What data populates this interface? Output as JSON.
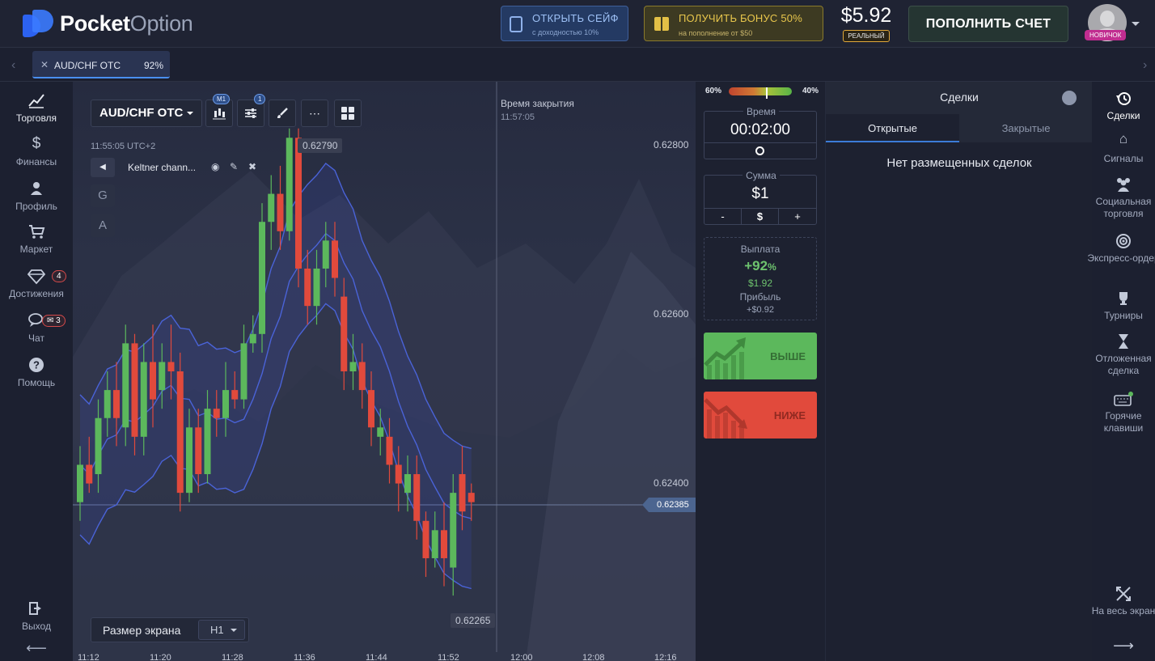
{
  "header": {
    "brand_bold": "Pocket",
    "brand_light": "Option",
    "safe_title": "ОТКРЫТЬ СЕЙФ",
    "safe_sub": "с доходностью 10%",
    "bonus_title": "ПОЛУЧИТЬ БОНУС 50%",
    "bonus_sub": "на пополнение от $50",
    "balance": "$5.92",
    "account_type": "РЕАЛЬНЫЙ",
    "deposit_label": "ПОПОЛНИТЬ СЧЕТ",
    "user_level": "НОВИЧОК"
  },
  "tabs": [
    {
      "asset": "AUD/CHF OTC",
      "payout": "92%"
    }
  ],
  "left_nav": [
    {
      "label": "Торговля",
      "icon": "chart-line-icon",
      "active": true
    },
    {
      "label": "Финансы",
      "icon": "dollar-icon"
    },
    {
      "label": "Профиль",
      "icon": "user-icon"
    },
    {
      "label": "Маркет",
      "icon": "cart-icon"
    },
    {
      "label": "Достижения",
      "icon": "diamond-icon",
      "badge": "4"
    },
    {
      "label": "Чат",
      "icon": "chat-icon",
      "badge": "3"
    },
    {
      "label": "Помощь",
      "icon": "help-icon"
    },
    {
      "label": "Выход",
      "icon": "logout-icon"
    }
  ],
  "chart": {
    "asset": "AUD/CHF OTC",
    "timeframe_badge": "M1",
    "indicators_badge": "1",
    "time_display": "11:55:05 UTC+2",
    "indicator_name": "Keltner chann...",
    "tool_g": "G",
    "tool_a": "A",
    "expiry_label": "Время закрытия",
    "expiry_time": "11:57:05",
    "high_marker": "0.62790",
    "low_marker": "0.62265",
    "current_price": "0.62385",
    "screen_size_label": "Размер экрана",
    "screen_size_value": "H1",
    "price_axis": [
      "0.62800",
      "0.62600",
      "0.62400"
    ],
    "time_axis": [
      "11:12",
      "11:20",
      "11:28",
      "11:36",
      "11:44",
      "11:52",
      "12:00",
      "12:08",
      "12:16"
    ]
  },
  "chart_data": {
    "type": "candlestick",
    "title": "AUD/CHF OTC",
    "candles": [
      {
        "o": 0.6239,
        "c": 0.6243,
        "h": 0.6245,
        "l": 0.6237,
        "dir": "up"
      },
      {
        "o": 0.6243,
        "c": 0.6241,
        "h": 0.6246,
        "l": 0.624,
        "dir": "down"
      },
      {
        "o": 0.6242,
        "c": 0.6248,
        "h": 0.625,
        "l": 0.624,
        "dir": "up"
      },
      {
        "o": 0.6248,
        "c": 0.6251,
        "h": 0.6253,
        "l": 0.6246,
        "dir": "up"
      },
      {
        "o": 0.6251,
        "c": 0.6248,
        "h": 0.6254,
        "l": 0.6245,
        "dir": "down"
      },
      {
        "o": 0.6247,
        "c": 0.6256,
        "h": 0.6258,
        "l": 0.6245,
        "dir": "up"
      },
      {
        "o": 0.6256,
        "c": 0.6246,
        "h": 0.6257,
        "l": 0.6244,
        "dir": "down"
      },
      {
        "o": 0.6246,
        "c": 0.6254,
        "h": 0.6256,
        "l": 0.6244,
        "dir": "up"
      },
      {
        "o": 0.6254,
        "c": 0.625,
        "h": 0.6258,
        "l": 0.6247,
        "dir": "down"
      },
      {
        "o": 0.6251,
        "c": 0.6254,
        "h": 0.6256,
        "l": 0.6249,
        "dir": "up"
      },
      {
        "o": 0.6254,
        "c": 0.6253,
        "h": 0.6258,
        "l": 0.625,
        "dir": "down"
      },
      {
        "o": 0.6253,
        "c": 0.624,
        "h": 0.6255,
        "l": 0.6238,
        "dir": "down"
      },
      {
        "o": 0.624,
        "c": 0.6247,
        "h": 0.6249,
        "l": 0.6239,
        "dir": "up"
      },
      {
        "o": 0.6247,
        "c": 0.6242,
        "h": 0.6249,
        "l": 0.624,
        "dir": "down"
      },
      {
        "o": 0.6242,
        "c": 0.6249,
        "h": 0.6251,
        "l": 0.6241,
        "dir": "up"
      },
      {
        "o": 0.6249,
        "c": 0.6248,
        "h": 0.6251,
        "l": 0.6246,
        "dir": "down"
      },
      {
        "o": 0.6248,
        "c": 0.6251,
        "h": 0.6254,
        "l": 0.6246,
        "dir": "up"
      },
      {
        "o": 0.6251,
        "c": 0.625,
        "h": 0.6253,
        "l": 0.6249,
        "dir": "down"
      },
      {
        "o": 0.625,
        "c": 0.6256,
        "h": 0.6258,
        "l": 0.6249,
        "dir": "up"
      },
      {
        "o": 0.6256,
        "c": 0.6257,
        "h": 0.6259,
        "l": 0.6255,
        "dir": "up"
      },
      {
        "o": 0.6257,
        "c": 0.6269,
        "h": 0.6271,
        "l": 0.6255,
        "dir": "up"
      },
      {
        "o": 0.6269,
        "c": 0.6272,
        "h": 0.6274,
        "l": 0.6266,
        "dir": "up"
      },
      {
        "o": 0.6272,
        "c": 0.6268,
        "h": 0.6275,
        "l": 0.6266,
        "dir": "down"
      },
      {
        "o": 0.6268,
        "c": 0.6278,
        "h": 0.6279,
        "l": 0.6267,
        "dir": "up"
      },
      {
        "o": 0.6278,
        "c": 0.6264,
        "h": 0.6279,
        "l": 0.6262,
        "dir": "down"
      },
      {
        "o": 0.6264,
        "c": 0.626,
        "h": 0.6266,
        "l": 0.6258,
        "dir": "down"
      },
      {
        "o": 0.626,
        "c": 0.6264,
        "h": 0.6266,
        "l": 0.6258,
        "dir": "up"
      },
      {
        "o": 0.6264,
        "c": 0.6267,
        "h": 0.6269,
        "l": 0.6262,
        "dir": "up"
      },
      {
        "o": 0.6267,
        "c": 0.6263,
        "h": 0.6269,
        "l": 0.6261,
        "dir": "down"
      },
      {
        "o": 0.6261,
        "c": 0.6253,
        "h": 0.6263,
        "l": 0.6251,
        "dir": "down"
      },
      {
        "o": 0.6253,
        "c": 0.6254,
        "h": 0.6257,
        "l": 0.6251,
        "dir": "up"
      },
      {
        "o": 0.6254,
        "c": 0.6251,
        "h": 0.6256,
        "l": 0.6249,
        "dir": "down"
      },
      {
        "o": 0.6251,
        "c": 0.6247,
        "h": 0.6253,
        "l": 0.6245,
        "dir": "down"
      },
      {
        "o": 0.6247,
        "c": 0.6246,
        "h": 0.6249,
        "l": 0.6244,
        "dir": "up"
      },
      {
        "o": 0.6246,
        "c": 0.6243,
        "h": 0.6248,
        "l": 0.6241,
        "dir": "down"
      },
      {
        "o": 0.6243,
        "c": 0.6241,
        "h": 0.6245,
        "l": 0.6238,
        "dir": "down"
      },
      {
        "o": 0.624,
        "c": 0.6242,
        "h": 0.6244,
        "l": 0.6238,
        "dir": "up"
      },
      {
        "o": 0.6242,
        "c": 0.6237,
        "h": 0.6244,
        "l": 0.6235,
        "dir": "down"
      },
      {
        "o": 0.6237,
        "c": 0.6233,
        "h": 0.6238,
        "l": 0.6231,
        "dir": "down"
      },
      {
        "o": 0.6233,
        "c": 0.6236,
        "h": 0.6238,
        "l": 0.6232,
        "dir": "up"
      },
      {
        "o": 0.6236,
        "c": 0.6233,
        "h": 0.6239,
        "l": 0.623,
        "dir": "down"
      },
      {
        "o": 0.6232,
        "c": 0.624,
        "h": 0.6242,
        "l": 0.6229,
        "dir": "up"
      },
      {
        "o": 0.6242,
        "c": 0.6238,
        "h": 0.6245,
        "l": 0.6236,
        "dir": "down"
      },
      {
        "o": 0.624,
        "c": 0.6239,
        "h": 0.6241,
        "l": 0.6237,
        "dir": "down"
      }
    ],
    "ylim": [
      0.6222,
      0.6284
    ],
    "colors": {
      "up": "#5cb85c",
      "down": "#e14a3c",
      "band": "#4a63d8"
    }
  },
  "trade": {
    "sent_left": "60%",
    "sent_right": "40%",
    "sent_buy_fraction": 0.6,
    "time_label": "Время",
    "time_value": "00:02:00",
    "amount_label": "Сумма",
    "amount_value": "$1",
    "minus": "-",
    "currency": "$",
    "plus": "+",
    "payout_label": "Выплата",
    "payout_pct": "+92",
    "payout_pct_sign": "%",
    "payout_amount": "$1.92",
    "profit_label": "Прибыль",
    "profit_value": "+$0.92",
    "up_label": "ВЫШЕ",
    "down_label": "НИЖЕ"
  },
  "deals": {
    "title": "Сделки",
    "tab_open": "Открытые",
    "tab_closed": "Закрытые",
    "empty": "Нет размещенных сделок"
  },
  "right_nav": [
    {
      "label": "Сделки",
      "icon": "history-icon",
      "active": true
    },
    {
      "label": "Сигналы",
      "icon": "signal-icon"
    },
    {
      "label": "Социальная торговля",
      "icon": "people-icon"
    },
    {
      "label": "Экспресс-ордер",
      "icon": "target-icon"
    },
    {
      "label": "Турниры",
      "icon": "trophy-icon"
    },
    {
      "label": "Отложенная сделка",
      "icon": "hourglass-icon"
    },
    {
      "label": "Горячие клавиши",
      "icon": "keyboard-icon"
    },
    {
      "label": "На весь экран",
      "icon": "fullscreen-icon"
    }
  ]
}
